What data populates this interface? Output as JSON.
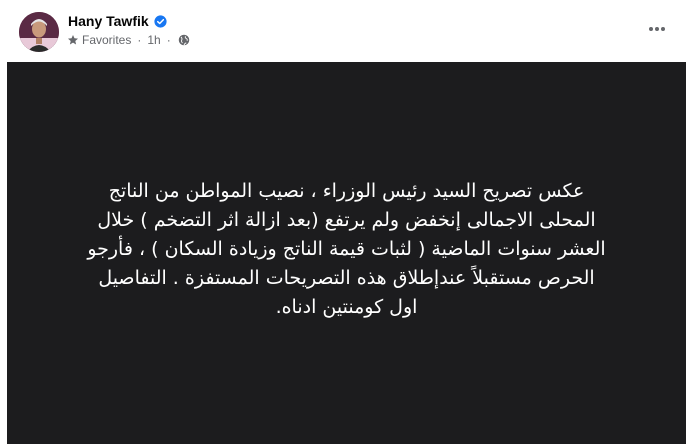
{
  "post": {
    "author": {
      "name": "Hany Tawfik",
      "verified": true
    },
    "meta": {
      "audience_label": "Favorites",
      "separator": "·",
      "time": "1h",
      "privacy_icon": "globe-icon"
    },
    "more_icon": "more-horizontal-icon",
    "text": "عكس تصريح السيد رئيس الوزراء ، نصيب المواطن من الناتج\nالمحلى الاجمالى إنخفض ولم يرتفع (بعد ازالة اثر التضخم ) خلال\nالعشر سنوات الماضية ( لثبات قيمة الناتج وزيادة السكان ) ، فأرجو\nالحرص مستقبلاً عندإطلاق هذه التصريحات المستفزة . التفاصيل\nاول كومنتين ادناه.",
    "colors": {
      "background": "#1c1c1e",
      "text": "#ffffff",
      "verified": "#1877f2",
      "meta_text": "#65676b"
    }
  }
}
